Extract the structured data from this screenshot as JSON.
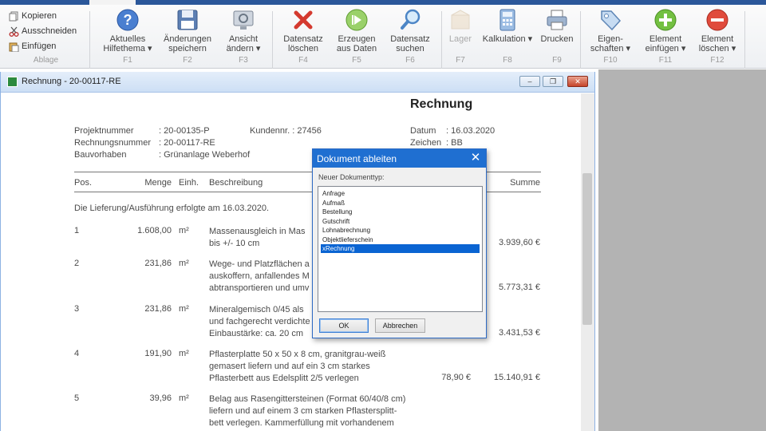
{
  "ribbon": {
    "clipboard": {
      "copy_label": "Kopieren",
      "cut_label": "Ausschneiden",
      "paste_label": "Einfügen",
      "group_label": "Ablage"
    },
    "buttons": [
      {
        "label": "Aktuelles\nHilfethema",
        "dropdown": true,
        "fkey": "F1",
        "icon": "help-icon"
      },
      {
        "label": "Änderungen\nspeichern",
        "dropdown": false,
        "fkey": "F2",
        "icon": "floppy-save-icon"
      },
      {
        "label": "Ansicht\nändern",
        "dropdown": true,
        "fkey": "F3",
        "icon": "view-monitor-icon"
      },
      {
        "label": "Datensatz\nlöschen",
        "dropdown": false,
        "fkey": "F4",
        "icon": "red-x-delete-icon"
      },
      {
        "label": "Erzeugen\naus Daten",
        "dropdown": false,
        "fkey": "F5",
        "icon": "green-play-icon"
      },
      {
        "label": "Datensatz\nsuchen",
        "dropdown": false,
        "fkey": "F6",
        "icon": "magnifier-icon"
      },
      {
        "label": "Lager",
        "dropdown": false,
        "fkey": "F7",
        "icon": "warehouse-box-icon",
        "disabled": true
      },
      {
        "label": "Kalkulation",
        "dropdown": true,
        "fkey": "F8",
        "icon": "calculator-icon"
      },
      {
        "label": "Drucken",
        "dropdown": false,
        "fkey": "F9",
        "icon": "printer-icon"
      },
      {
        "label": "Eigen-\nschaften",
        "dropdown": true,
        "fkey": "F10",
        "icon": "tag-properties-icon"
      },
      {
        "label": "Element\neinfügen",
        "dropdown": true,
        "fkey": "F11",
        "icon": "green-plus-icon"
      },
      {
        "label": "Element\nlöschen",
        "dropdown": true,
        "fkey": "F12",
        "icon": "red-minus-icon"
      }
    ]
  },
  "document_window": {
    "title": "Rechnung - 20-00117-RE",
    "minimize_label": "–",
    "restore_label": "❐",
    "close_label": "✕"
  },
  "invoice": {
    "title": "Rechnung",
    "project_number_label": "Projektnummer",
    "project_number_value": ": 20-00135-P",
    "invoice_number_label": "Rechnungsnummer",
    "invoice_number_value": ": 20-00117-RE",
    "construction_label": "Bauvorhaben",
    "construction_value": ": Grünanlage Weberhof",
    "customer_label": "Kundennr. : 27456",
    "date_label": "Datum",
    "date_value": ": 16.03.2020",
    "sign_label": "Zeichen",
    "sign_value": ": BB",
    "columns": {
      "pos": "Pos.",
      "qty": "Menge",
      "unit": "Einh.",
      "desc": "Beschreibung",
      "sum": "Summe"
    },
    "delivery_note": "Die Lieferung/Ausführung erfolgte am 16.03.2020.",
    "positions": [
      {
        "pos": "1",
        "qty": "1.608,00",
        "unit": "m²",
        "desc": [
          "Massenausgleich in Mas",
          "bis +/- 10 cm"
        ],
        "price": "",
        "sum": "3.939,60 €"
      },
      {
        "pos": "2",
        "qty": "231,86",
        "unit": "m²",
        "desc": [
          "Wege- und Platzflächen a",
          "auskoffern, anfallendes M",
          "abtransportieren und umv"
        ],
        "price": "",
        "sum": "5.773,31 €"
      },
      {
        "pos": "3",
        "qty": "231,86",
        "unit": "m²",
        "desc": [
          "Mineralgemisch 0/45 als",
          "und fachgerecht verdichte",
          "Einbaustärke: ca. 20 cm"
        ],
        "price": "",
        "sum": "3.431,53 €"
      },
      {
        "pos": "4",
        "qty": "191,90",
        "unit": "m²",
        "desc": [
          "Pflasterplatte 50 x 50 x 8 cm, granitgrau-weiß",
          "gemasert liefern und auf ein 3 cm starkes",
          "Pflasterbett aus Edelsplitt 2/5 verlegen"
        ],
        "price": "78,90 €",
        "sum": "15.140,91 €"
      },
      {
        "pos": "5",
        "qty": "39,96",
        "unit": "m²",
        "desc": [
          "Belag aus Rasengittersteinen (Format 60/40/8 cm)",
          "liefern und auf einem 3 cm starken Pflastersplitt-",
          "bett verlegen. Kammerfüllung mit vorhandenem",
          "Oberboden (Mutterboden) inkl. Grasansaat"
        ],
        "price": "",
        "sum": ""
      }
    ]
  },
  "dialog": {
    "title": "Dokument ableiten",
    "close_label": "✕",
    "list_label": "Neuer Dokumenttyp:",
    "items": [
      "Anfrage",
      "Aufmaß",
      "Bestellung",
      "Gutschrift",
      "Lohnabrechnung",
      "Objektlieferschein",
      "xRechnung"
    ],
    "selected_index": 6,
    "ok_label": "OK",
    "cancel_label": "Abbrechen"
  }
}
